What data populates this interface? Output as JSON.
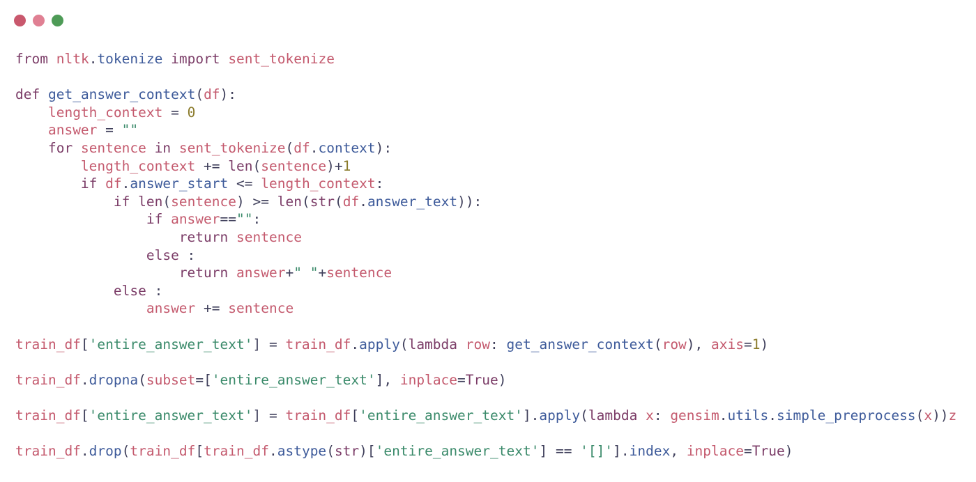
{
  "window": {
    "buttons": [
      {
        "name": "close",
        "color": "#c9586d"
      },
      {
        "name": "minimize",
        "color": "#e08093"
      },
      {
        "name": "maximize",
        "color": "#4e9b57"
      }
    ]
  },
  "code": {
    "lines": [
      [
        {
          "t": "k",
          "v": "from"
        },
        {
          "t": "p",
          "v": " "
        },
        {
          "t": "v",
          "v": "nltk"
        },
        {
          "t": "p",
          "v": "."
        },
        {
          "t": "f",
          "v": "tokenize"
        },
        {
          "t": "p",
          "v": " "
        },
        {
          "t": "k",
          "v": "import"
        },
        {
          "t": "p",
          "v": " "
        },
        {
          "t": "v",
          "v": "sent_tokenize"
        }
      ],
      [],
      [
        {
          "t": "k",
          "v": "def"
        },
        {
          "t": "p",
          "v": " "
        },
        {
          "t": "f",
          "v": "get_answer_context"
        },
        {
          "t": "p",
          "v": "("
        },
        {
          "t": "v",
          "v": "df"
        },
        {
          "t": "p",
          "v": "):"
        }
      ],
      [
        {
          "t": "p",
          "v": "    "
        },
        {
          "t": "v",
          "v": "length_context"
        },
        {
          "t": "p",
          "v": " = "
        },
        {
          "t": "n",
          "v": "0"
        }
      ],
      [
        {
          "t": "p",
          "v": "    "
        },
        {
          "t": "v",
          "v": "answer"
        },
        {
          "t": "p",
          "v": " = "
        },
        {
          "t": "s",
          "v": "\"\""
        }
      ],
      [
        {
          "t": "p",
          "v": "    "
        },
        {
          "t": "k",
          "v": "for"
        },
        {
          "t": "p",
          "v": " "
        },
        {
          "t": "v",
          "v": "sentence"
        },
        {
          "t": "p",
          "v": " "
        },
        {
          "t": "k",
          "v": "in"
        },
        {
          "t": "p",
          "v": " "
        },
        {
          "t": "v",
          "v": "sent_tokenize"
        },
        {
          "t": "p",
          "v": "("
        },
        {
          "t": "v",
          "v": "df"
        },
        {
          "t": "p",
          "v": "."
        },
        {
          "t": "f",
          "v": "context"
        },
        {
          "t": "p",
          "v": "):"
        }
      ],
      [
        {
          "t": "p",
          "v": "        "
        },
        {
          "t": "v",
          "v": "length_context"
        },
        {
          "t": "p",
          "v": " += "
        },
        {
          "t": "b",
          "v": "len"
        },
        {
          "t": "p",
          "v": "("
        },
        {
          "t": "v",
          "v": "sentence"
        },
        {
          "t": "p",
          "v": ")+"
        },
        {
          "t": "n",
          "v": "1"
        }
      ],
      [
        {
          "t": "p",
          "v": "        "
        },
        {
          "t": "k",
          "v": "if"
        },
        {
          "t": "p",
          "v": " "
        },
        {
          "t": "v",
          "v": "df"
        },
        {
          "t": "p",
          "v": "."
        },
        {
          "t": "f",
          "v": "answer_start"
        },
        {
          "t": "p",
          "v": " <= "
        },
        {
          "t": "v",
          "v": "length_context"
        },
        {
          "t": "p",
          "v": ":"
        }
      ],
      [
        {
          "t": "p",
          "v": "            "
        },
        {
          "t": "k",
          "v": "if"
        },
        {
          "t": "p",
          "v": " "
        },
        {
          "t": "b",
          "v": "len"
        },
        {
          "t": "p",
          "v": "("
        },
        {
          "t": "v",
          "v": "sentence"
        },
        {
          "t": "p",
          "v": ") >= "
        },
        {
          "t": "b",
          "v": "len"
        },
        {
          "t": "p",
          "v": "("
        },
        {
          "t": "b",
          "v": "str"
        },
        {
          "t": "p",
          "v": "("
        },
        {
          "t": "v",
          "v": "df"
        },
        {
          "t": "p",
          "v": "."
        },
        {
          "t": "f",
          "v": "answer_text"
        },
        {
          "t": "p",
          "v": ")):"
        }
      ],
      [
        {
          "t": "p",
          "v": "                "
        },
        {
          "t": "k",
          "v": "if"
        },
        {
          "t": "p",
          "v": " "
        },
        {
          "t": "v",
          "v": "answer"
        },
        {
          "t": "p",
          "v": "=="
        },
        {
          "t": "s",
          "v": "\"\""
        },
        {
          "t": "p",
          "v": ":"
        }
      ],
      [
        {
          "t": "p",
          "v": "                    "
        },
        {
          "t": "k",
          "v": "return"
        },
        {
          "t": "p",
          "v": " "
        },
        {
          "t": "v",
          "v": "sentence"
        }
      ],
      [
        {
          "t": "p",
          "v": "                "
        },
        {
          "t": "k",
          "v": "else"
        },
        {
          "t": "p",
          "v": " :"
        }
      ],
      [
        {
          "t": "p",
          "v": "                    "
        },
        {
          "t": "k",
          "v": "return"
        },
        {
          "t": "p",
          "v": " "
        },
        {
          "t": "v",
          "v": "answer"
        },
        {
          "t": "p",
          "v": "+"
        },
        {
          "t": "s",
          "v": "\" \""
        },
        {
          "t": "p",
          "v": "+"
        },
        {
          "t": "v",
          "v": "sentence"
        }
      ],
      [
        {
          "t": "p",
          "v": "            "
        },
        {
          "t": "k",
          "v": "else"
        },
        {
          "t": "p",
          "v": " :"
        }
      ],
      [
        {
          "t": "p",
          "v": "                "
        },
        {
          "t": "v",
          "v": "answer"
        },
        {
          "t": "p",
          "v": " += "
        },
        {
          "t": "v",
          "v": "sentence"
        }
      ],
      [],
      [
        {
          "t": "v",
          "v": "train_df"
        },
        {
          "t": "p",
          "v": "["
        },
        {
          "t": "s",
          "v": "'entire_answer_text'"
        },
        {
          "t": "p",
          "v": "] = "
        },
        {
          "t": "v",
          "v": "train_df"
        },
        {
          "t": "p",
          "v": "."
        },
        {
          "t": "f",
          "v": "apply"
        },
        {
          "t": "p",
          "v": "("
        },
        {
          "t": "k",
          "v": "lambda"
        },
        {
          "t": "p",
          "v": " "
        },
        {
          "t": "v",
          "v": "row"
        },
        {
          "t": "p",
          "v": ": "
        },
        {
          "t": "f",
          "v": "get_answer_context"
        },
        {
          "t": "p",
          "v": "("
        },
        {
          "t": "v",
          "v": "row"
        },
        {
          "t": "p",
          "v": "), "
        },
        {
          "t": "v",
          "v": "axis"
        },
        {
          "t": "p",
          "v": "="
        },
        {
          "t": "n",
          "v": "1"
        },
        {
          "t": "p",
          "v": ")"
        }
      ],
      [],
      [
        {
          "t": "v",
          "v": "train_df"
        },
        {
          "t": "p",
          "v": "."
        },
        {
          "t": "f",
          "v": "dropna"
        },
        {
          "t": "p",
          "v": "("
        },
        {
          "t": "v",
          "v": "subset"
        },
        {
          "t": "p",
          "v": "=["
        },
        {
          "t": "s",
          "v": "'entire_answer_text'"
        },
        {
          "t": "p",
          "v": "], "
        },
        {
          "t": "v",
          "v": "inplace"
        },
        {
          "t": "p",
          "v": "="
        },
        {
          "t": "k",
          "v": "True"
        },
        {
          "t": "p",
          "v": ")"
        }
      ],
      [],
      [
        {
          "t": "v",
          "v": "train_df"
        },
        {
          "t": "p",
          "v": "["
        },
        {
          "t": "s",
          "v": "'entire_answer_text'"
        },
        {
          "t": "p",
          "v": "] = "
        },
        {
          "t": "v",
          "v": "train_df"
        },
        {
          "t": "p",
          "v": "["
        },
        {
          "t": "s",
          "v": "'entire_answer_text'"
        },
        {
          "t": "p",
          "v": "]."
        },
        {
          "t": "f",
          "v": "apply"
        },
        {
          "t": "p",
          "v": "("
        },
        {
          "t": "k",
          "v": "lambda"
        },
        {
          "t": "p",
          "v": " "
        },
        {
          "t": "v",
          "v": "x"
        },
        {
          "t": "p",
          "v": ": "
        },
        {
          "t": "v",
          "v": "gensim"
        },
        {
          "t": "p",
          "v": "."
        },
        {
          "t": "f",
          "v": "utils"
        },
        {
          "t": "p",
          "v": "."
        },
        {
          "t": "f",
          "v": "simple_preprocess"
        },
        {
          "t": "p",
          "v": "("
        },
        {
          "t": "v",
          "v": "x"
        },
        {
          "t": "p",
          "v": "))"
        },
        {
          "t": "v",
          "v": "z"
        }
      ],
      [],
      [
        {
          "t": "v",
          "v": "train_df"
        },
        {
          "t": "p",
          "v": "."
        },
        {
          "t": "f",
          "v": "drop"
        },
        {
          "t": "p",
          "v": "("
        },
        {
          "t": "v",
          "v": "train_df"
        },
        {
          "t": "p",
          "v": "["
        },
        {
          "t": "v",
          "v": "train_df"
        },
        {
          "t": "p",
          "v": "."
        },
        {
          "t": "f",
          "v": "astype"
        },
        {
          "t": "p",
          "v": "("
        },
        {
          "t": "b",
          "v": "str"
        },
        {
          "t": "p",
          "v": ")["
        },
        {
          "t": "s",
          "v": "'entire_answer_text'"
        },
        {
          "t": "p",
          "v": "] == "
        },
        {
          "t": "s",
          "v": "'[]'"
        },
        {
          "t": "p",
          "v": "]."
        },
        {
          "t": "f",
          "v": "index"
        },
        {
          "t": "p",
          "v": ", "
        },
        {
          "t": "v",
          "v": "inplace"
        },
        {
          "t": "p",
          "v": "="
        },
        {
          "t": "k",
          "v": "True"
        },
        {
          "t": "p",
          "v": ")"
        }
      ]
    ]
  }
}
